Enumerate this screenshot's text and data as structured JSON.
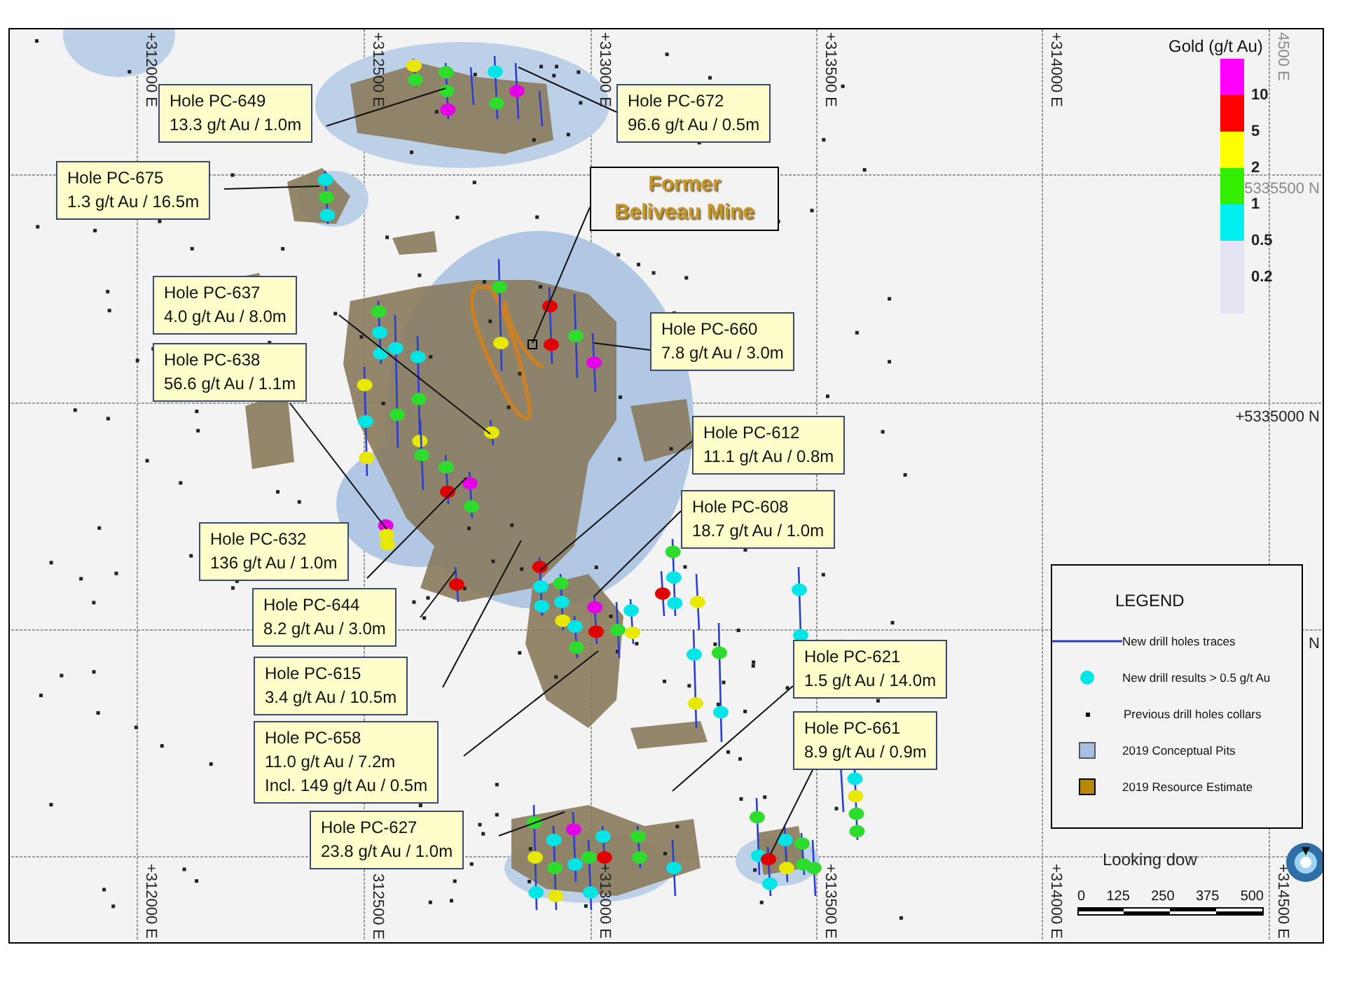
{
  "map": {
    "easting_labels_top": [
      "+312000 E",
      "+312500 E",
      "+313000 E",
      "+313500 E",
      "+314000 E",
      "4500 E"
    ],
    "easting_labels_bottom": [
      "+312000 E",
      "312500 E",
      "+313000 E",
      "+313500 E",
      "+314000 E",
      "+314500 E"
    ],
    "northing_labels": [
      "5335500 N",
      "+5335000 N",
      "N"
    ],
    "callouts": [
      {
        "title": "Hole PC-649",
        "lines": [
          "13.3 g/t Au / 1.0m"
        ]
      },
      {
        "title": "Hole PC-672",
        "lines": [
          "96.6 g/t Au /  0.5m"
        ]
      },
      {
        "title": "Hole PC-675",
        "lines": [
          "1.3 g/t Au / 16.5m"
        ]
      },
      {
        "title": "Hole PC-637",
        "lines": [
          "4.0 g/t Au / 8.0m"
        ]
      },
      {
        "title": "Hole PC-660",
        "lines": [
          "7.8 g/t Au / 3.0m"
        ]
      },
      {
        "title": "Hole PC-638",
        "lines": [
          "56.6 g/t Au / 1.1m"
        ]
      },
      {
        "title": "Hole PC-612",
        "lines": [
          "11.1 g/t Au / 0.8m"
        ]
      },
      {
        "title": "Hole PC-608",
        "lines": [
          "18.7 g/t Au / 1.0m"
        ]
      },
      {
        "title": "Hole PC-632",
        "lines": [
          "136 g/t Au / 1.0m"
        ]
      },
      {
        "title": "Hole PC-644",
        "lines": [
          "8.2 g/t Au / 3.0m"
        ]
      },
      {
        "title": "Hole PC-615",
        "lines": [
          "3.4 g/t Au / 10.5m"
        ]
      },
      {
        "title": "Hole PC-658",
        "lines": [
          "11.0 g/t Au / 7.2m",
          "Incl. 149 g/t Au / 0.5m"
        ]
      },
      {
        "title": "Hole PC-627",
        "lines": [
          "23.8 g/t Au / 1.0m"
        ]
      },
      {
        "title": "Hole PC-621",
        "lines": [
          "1.5 g/t Au / 14.0m"
        ]
      },
      {
        "title": "Hole PC-661",
        "lines": [
          "8.9 g/t Au / 0.9m"
        ]
      }
    ],
    "mine_label": {
      "lines": [
        "Former",
        "Beliveau Mine"
      ]
    },
    "view_label": "Looking dow"
  },
  "color_scale": {
    "title": "Gold (g/t Au)",
    "bands": [
      {
        "color": "#ff00ff",
        "label": "10"
      },
      {
        "color": "#ff0000",
        "label": "5"
      },
      {
        "color": "#ffff00",
        "label": "2"
      },
      {
        "color": "#33ee00",
        "label": "1"
      },
      {
        "color": "#00f0f0",
        "label": "0.5"
      },
      {
        "color": "#e4e4f4",
        "label": "0.2"
      }
    ]
  },
  "legend": {
    "title": "LEGEND",
    "items": [
      {
        "kind": "line",
        "label": "New drill holes traces"
      },
      {
        "kind": "result",
        "label": "New drill results > 0.5 g/t Au"
      },
      {
        "kind": "collar",
        "label": "Previous drill holes collars"
      },
      {
        "kind": "pit",
        "label": "2019 Conceptual Pits"
      },
      {
        "kind": "resource",
        "label": "2019 Resource Estimate"
      }
    ]
  },
  "scale_bar": {
    "ticks": [
      "0",
      "125",
      "250",
      "375",
      "500"
    ]
  }
}
